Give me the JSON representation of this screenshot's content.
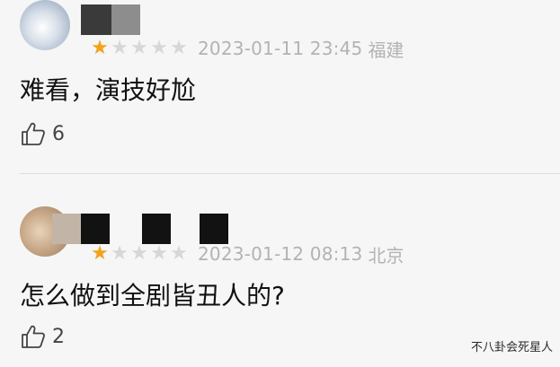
{
  "reviews": [
    {
      "rating": 1,
      "max_rating": 5,
      "date": "2023-01-11 23:45",
      "location": "福建",
      "text": "难看，演技好尬",
      "likes": "6"
    },
    {
      "rating": 1,
      "max_rating": 5,
      "date": "2023-01-12 08:13",
      "location": "北京",
      "text": "怎么做到全剧皆丑人的?",
      "likes": "2"
    }
  ],
  "watermark": "不八卦会死星人",
  "colors": {
    "star_filled": "#f3a21b",
    "star_empty": "#d7d7d7",
    "meta_text": "#b3b3b3",
    "background": "#f6f6f6"
  },
  "icons": {
    "like": "thumbs-up-outline-icon",
    "star": "star-icon"
  }
}
